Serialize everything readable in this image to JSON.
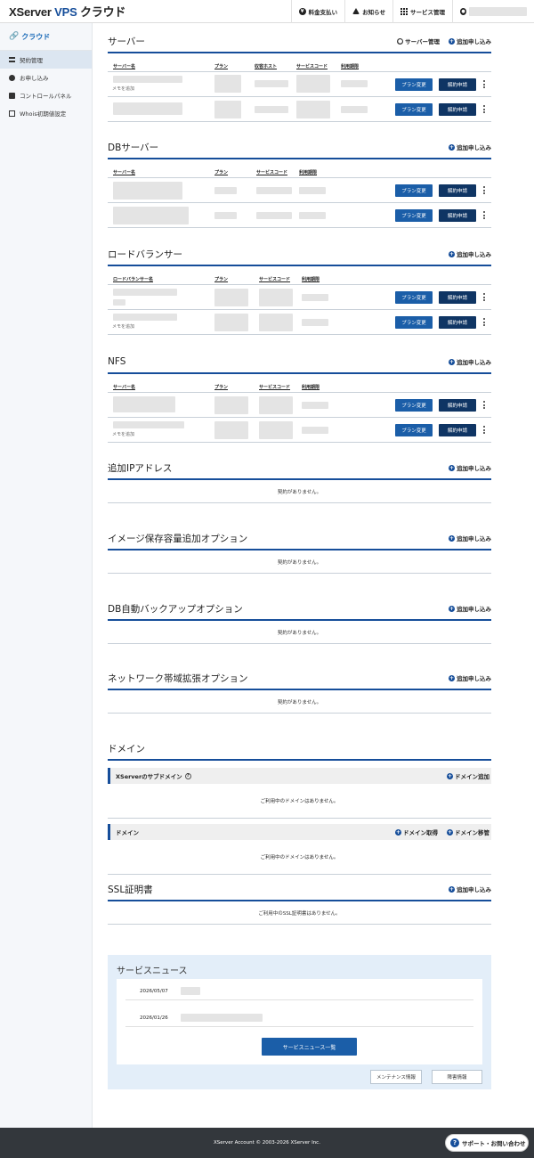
{
  "header": {
    "logo_part1": "XServer ",
    "logo_part2": "VPS",
    "logo_part3": " クラウド",
    "billing": "料金支払い",
    "notice": "お知らせ",
    "service": "サービス管理"
  },
  "sidebar": {
    "title": "クラウド",
    "items": [
      {
        "label": "契約管理"
      },
      {
        "label": "お申し込み"
      },
      {
        "label": "コントロールパネル"
      },
      {
        "label": "Whois初期値設定"
      }
    ]
  },
  "common": {
    "add": "追加申し込み",
    "plan_change": "プラン変更",
    "cancel": "解約申請",
    "memo": "メモを追加",
    "no_contract": "契約がありません。"
  },
  "server": {
    "title": "サーバー",
    "manage": "サーバー管理",
    "cols": [
      "サーバー名",
      "プラン",
      "収容ホスト",
      "サービスコード",
      "利用期限"
    ]
  },
  "db": {
    "title": "DBサーバー",
    "cols": [
      "サーバー名",
      "プラン",
      "サービスコード",
      "利用期限"
    ]
  },
  "lb": {
    "title": "ロードバランサー",
    "cols": [
      "ロードバランサー名",
      "プラン",
      "サービスコード",
      "利用期限"
    ]
  },
  "nfs": {
    "title": "NFS",
    "cols": [
      "サーバー名",
      "プラン",
      "サービスコード",
      "利用期限"
    ]
  },
  "ip": {
    "title": "追加IPアドレス"
  },
  "image": {
    "title": "イメージ保存容量追加オプション"
  },
  "dbbackup": {
    "title": "DB自動バックアップオプション"
  },
  "network": {
    "title": "ネットワーク帯域拡張オプション"
  },
  "domain": {
    "title": "ドメイン",
    "sub1": "XServerのサブドメイン",
    "sub1_add": "ドメイン追加",
    "sub2": "ドメイン",
    "sub2_get": "ドメイン取得",
    "sub2_move": "ドメイン移管",
    "empty": "ご利用中のドメインはありません。"
  },
  "ssl": {
    "title": "SSL証明書",
    "empty": "ご利用中のSSL証明書はありません。"
  },
  "news": {
    "title": "サービスニュース",
    "dates": [
      "2026/05/07",
      "2026/01/26"
    ],
    "list_button": "サービスニュース一覧",
    "maintenance": "メンテナンス情報",
    "failure": "障害情報"
  },
  "footer": {
    "copyright": "XServer Account © 2003-2026 XServer Inc.",
    "support": "サポート・お問い合わせ"
  }
}
